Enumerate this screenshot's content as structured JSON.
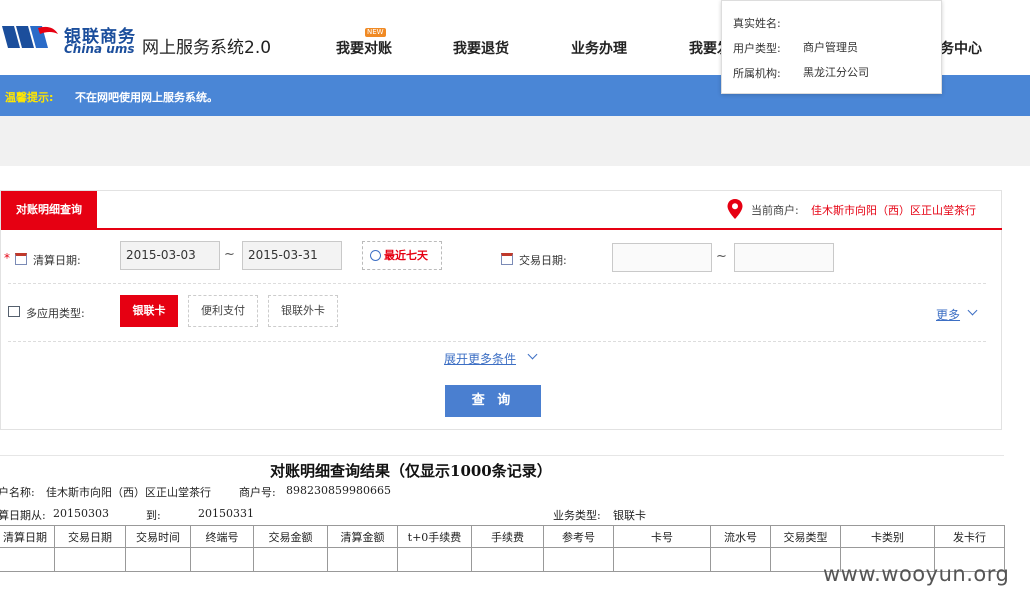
{
  "brand": {
    "name_cn": "银联商务",
    "name_en": "China ums",
    "system_title": "网上服务系统2.0"
  },
  "nav": {
    "new_badge": "NEW",
    "items": [
      {
        "label": "我要对账"
      },
      {
        "label": "我要退货"
      },
      {
        "label": "业务办理"
      },
      {
        "label": "我要发"
      },
      {
        "label": "务中心"
      }
    ]
  },
  "user_popup": {
    "real_name_label": "真实姓名:",
    "real_name_value": "",
    "user_type_label": "用户类型:",
    "user_type_value": "商户管理员",
    "org_label": "所属机构:",
    "org_value": "黑龙江分公司"
  },
  "notice": {
    "label": "温馨提示:",
    "text": "不在网吧使用网上服务系统。"
  },
  "query_panel": {
    "tab_title": "对账明细查询",
    "current_merchant_label": "当前商户:",
    "current_merchant_value": "佳木斯市向阳（西）区正山堂茶行",
    "required_mark": "*",
    "settle_date_label": "清算日期:",
    "settle_date_from": "2015-03-03",
    "settle_date_to": "2015-03-31",
    "tilde": "~",
    "recent_seven_days": "最近七天",
    "trade_date_label": "交易日期:",
    "trade_date_from": "",
    "trade_date_to": "",
    "app_type_label": "多应用类型:",
    "app_types": [
      "银联卡",
      "便利支付",
      "银联外卡"
    ],
    "more_label": "更多",
    "expand_label": "展开更多条件",
    "query_button": "查 询"
  },
  "results": {
    "title": "对账明细查询结果（仅显示1000条记录）",
    "merchant_name_label": "户名称:",
    "merchant_name_value": "佳木斯市向阳（西）区正山堂茶行",
    "merchant_no_label": "商户号:",
    "merchant_no_value": "898230859980665",
    "settle_from_label": "算日期从:",
    "settle_from_value": "20150303",
    "to_label": "到:",
    "to_value": "20150331",
    "biz_type_label": "业务类型:",
    "biz_type_value": "银联卡",
    "columns": [
      "清算日期",
      "交易日期",
      "交易时间",
      "终端号",
      "交易金额",
      "清算金额",
      "t+0手续费",
      "手续费",
      "参考号",
      "卡号",
      "流水号",
      "交易类型",
      "卡类别",
      "发卡行"
    ]
  },
  "watermark": "www.wooyun.org",
  "colors": {
    "brand_blue": "#1b4e9c",
    "notice_blue": "#4a86d6",
    "accent_red": "#e60012",
    "button_blue": "#4a7fd0",
    "link_blue": "#3d6fc4"
  }
}
